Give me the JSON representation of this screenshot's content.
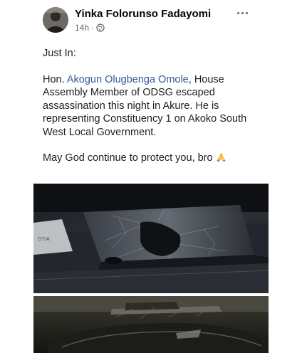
{
  "post": {
    "author": "Yinka Folorunso Fadayomi",
    "time": "14h",
    "separator": "·",
    "privacy_icon": "globe-icon",
    "more_icon": "more-options-icon",
    "paragraph1": "Just In:",
    "paragraph2": {
      "prefix": "Hon. ",
      "mention": "Akogun Olugbenga Omole",
      "suffix": ", House Assembly Member of ODSG escaped assassination this night in Akure. He is representing Constituency 1 on Akoko South West Local Government."
    },
    "paragraph3": "May God continue to protect you, bro",
    "emoji": "folded-hands-emoji"
  },
  "photos": [
    {
      "name": "shattered-car-window-photo"
    },
    {
      "name": "car-at-night-photo"
    }
  ],
  "colors": {
    "author_text": "#050505",
    "meta_text": "#65676b",
    "mention_link": "#385898",
    "body_text": "#1c1e21"
  }
}
